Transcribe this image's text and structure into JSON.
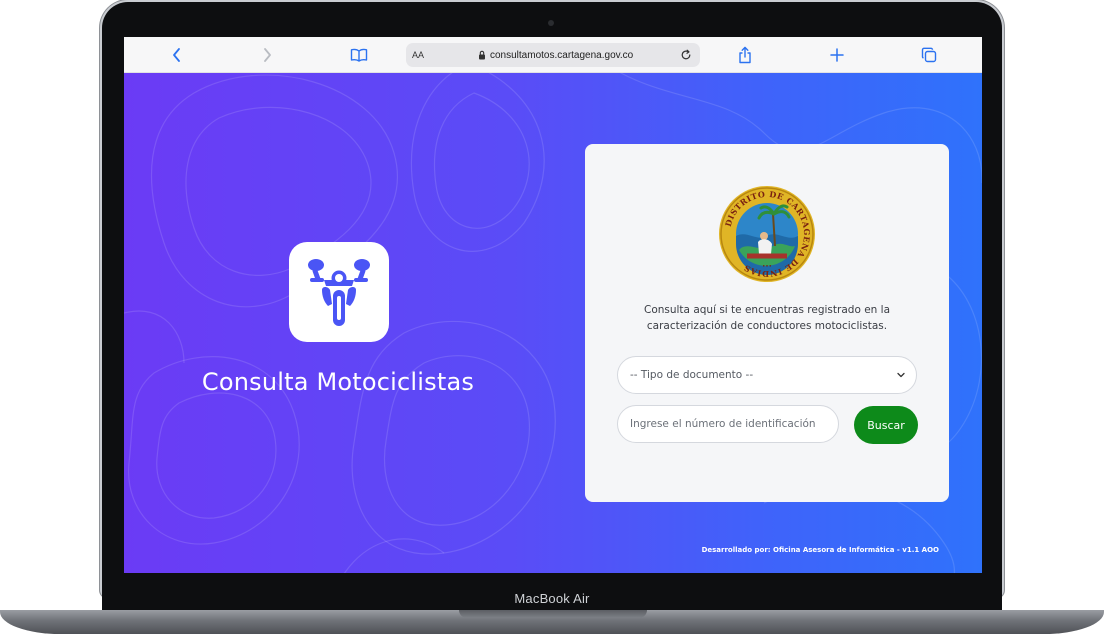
{
  "device": {
    "brand_label": "MacBook Air"
  },
  "browser": {
    "text_size_label": "AA",
    "url": "consultamotos.cartagena.gov.co",
    "icons": {
      "back": "chevron-left-icon",
      "forward": "chevron-right-icon",
      "reader": "book-icon",
      "lock": "lock-icon",
      "reload": "reload-icon",
      "share": "share-icon",
      "new_tab": "plus-icon",
      "tabs": "tabs-icon"
    },
    "accent_color": "#2b72f0"
  },
  "hero": {
    "title": "Consulta Motociclistas",
    "logo_icon": "motorcycle-icon",
    "logo_icon_color": "#4a55f5",
    "background_colors": [
      "#6b3bf5",
      "#2f72fb"
    ]
  },
  "card": {
    "seal_icon": "cartagena-seal-icon",
    "seal_text": "DISTRITO DE CARTAGENA DE INDIAS",
    "description_line1": "Consulta aquí si te encuentras registrado en la",
    "description_line2": "caracterización de conductores motociclistas.",
    "document_type_selected": "-- Tipo de documento --",
    "id_placeholder": "Ingrese el número de identificación",
    "search_button_label": "Buscar",
    "search_button_color": "#0d8a1a"
  },
  "footer": {
    "credit": "Desarrollado por: Oficina Asesora de Informática - v1.1 AOO"
  }
}
